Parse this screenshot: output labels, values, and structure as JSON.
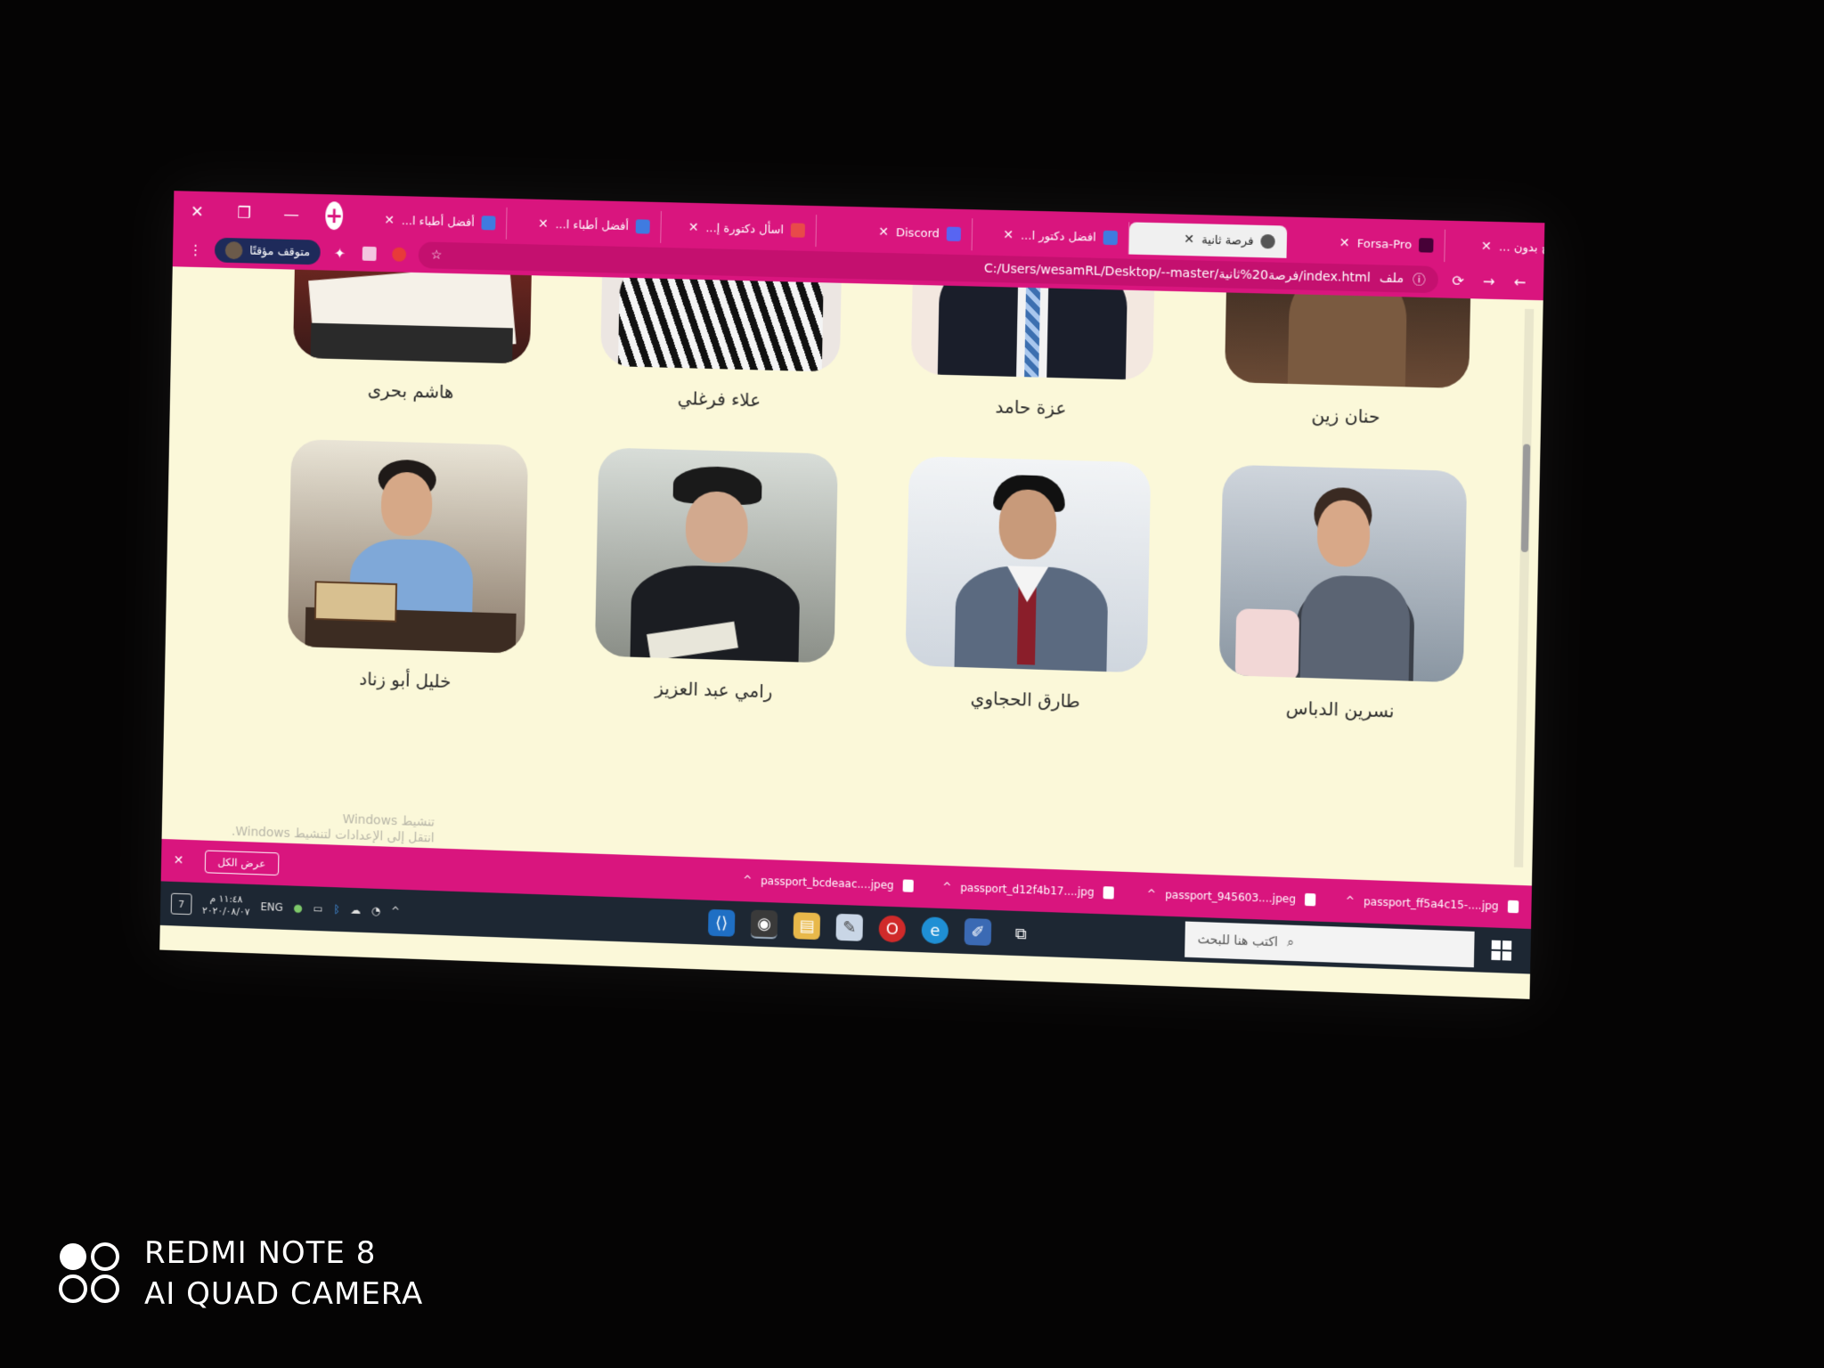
{
  "browser": {
    "window_controls": {
      "close": "✕",
      "restore": "❐",
      "minimize": "—"
    },
    "new_tab": "+",
    "tabs": [
      {
        "label": "أفضل أطباء ا...",
        "close": "✕",
        "favicon_color": "#3f7be0",
        "active": false
      },
      {
        "label": "أفضل أطباء ا...",
        "close": "✕",
        "favicon_color": "#3f7be0",
        "active": false
      },
      {
        "label": "اسأل دكتورة إ...",
        "close": "✕",
        "favicon_color": "#e84a4a",
        "active": false
      },
      {
        "label": "Discord",
        "close": "✕",
        "favicon_color": "#5865f2",
        "active": false
      },
      {
        "label": "افضل دكتور ا...",
        "close": "✕",
        "favicon_color": "#3f7be0",
        "active": false
      },
      {
        "label": "فرصة ثانية",
        "close": "✕",
        "favicon_color": "#555555",
        "active": true
      },
      {
        "label": "Forsa-Pro",
        "close": "✕",
        "favicon_color": "#470137",
        "active": false
      },
      {
        "label": "نموذج بدون ...",
        "close": "✕",
        "favicon_color": "#6a5acd",
        "active": false
      }
    ],
    "profile": "متوقف مؤقتًا",
    "omnibox": {
      "scheme_label": "ملف",
      "url": "C:/Users/wesamRL/Desktop/--master/فرصة20%ثانية/index.html"
    }
  },
  "page": {
    "top_row": [
      {
        "name": "هاشم بحرى"
      },
      {
        "name": "علاء فرغلي"
      },
      {
        "name": "عزة حامد"
      },
      {
        "name": "حنان زين"
      }
    ],
    "bottom_row": [
      {
        "name": "خليل أبو زناد"
      },
      {
        "name": "رامي عبد العزيز"
      },
      {
        "name": "طارق الحجاوي"
      },
      {
        "name": "نسرين الدباس"
      }
    ],
    "activation": {
      "line1": "تنشيط Windows",
      "line2": "انتقل إلى الإعدادات لتنشيط Windows."
    }
  },
  "downloads": {
    "items": [
      {
        "file": "passport_bcdeaac....jpeg"
      },
      {
        "file": "passport_d12f4b17....jpg"
      },
      {
        "file": "passport_945603....jpeg"
      },
      {
        "file": "passport_ff5a4c15-....jpg"
      }
    ],
    "show_all": "عرض الكل",
    "close": "✕"
  },
  "taskbar": {
    "search_placeholder": "اكتب هنا للبحث",
    "language": "ENG",
    "time": "١١:٤٨ م",
    "date": "٢٠٢٠/٠٨/٠٧",
    "notification_count": "7"
  },
  "watermark": {
    "line1": "REDMI NOTE 8",
    "line2": "AI QUAD CAMERA"
  },
  "colors": {
    "brand": "#d9157e",
    "page_bg": "#fbf8d9",
    "taskbar": "#1d2733"
  }
}
